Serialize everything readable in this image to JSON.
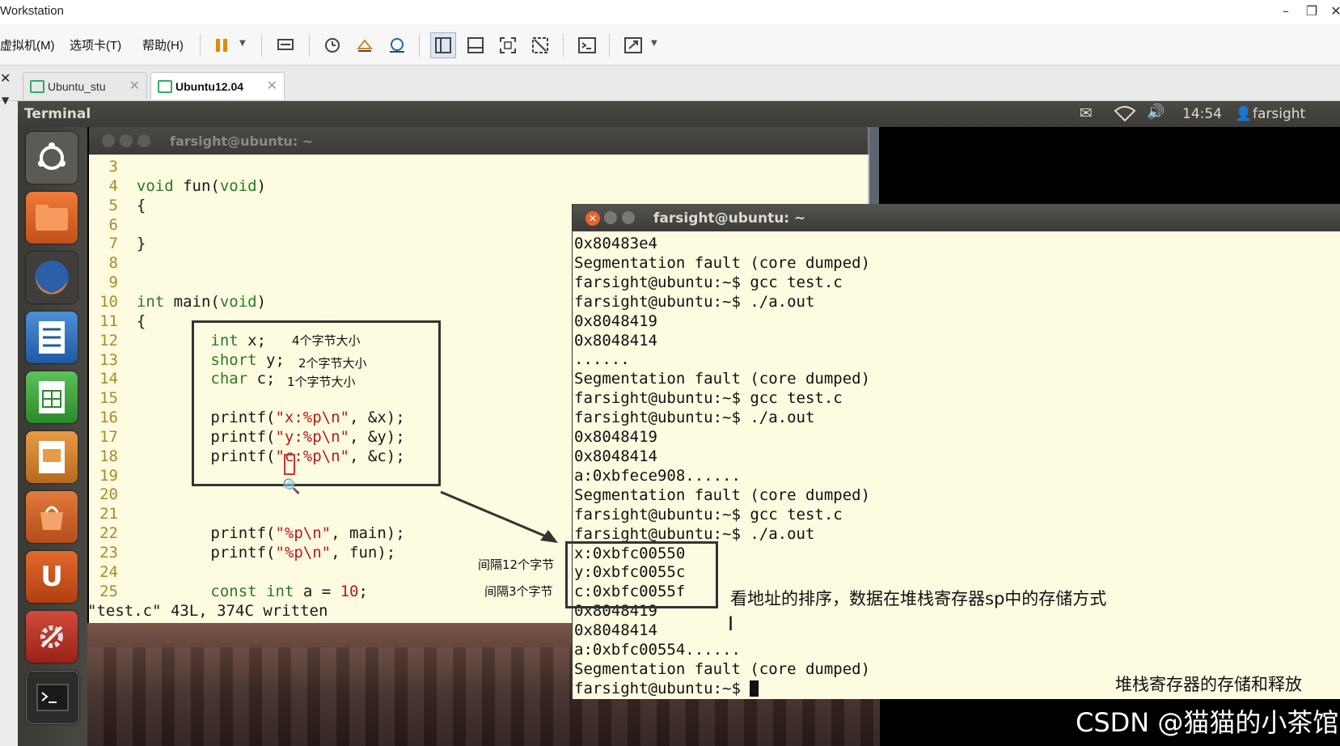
{
  "app": {
    "title": "Workstation"
  },
  "menu": [
    "虚拟机(M)",
    "选项卡(T)",
    "帮助(H)"
  ],
  "tabs": [
    {
      "label": "Ubuntu_stu",
      "active": false
    },
    {
      "label": "Ubuntu12.04",
      "active": true
    }
  ],
  "panel": {
    "app_name": "Terminal",
    "time": "14:54",
    "user": "farsight"
  },
  "vim": {
    "title": "farsight@ubuntu: ~",
    "lines": [
      {
        "n": "3",
        "code": ""
      },
      {
        "n": "4",
        "code": "void fun(void)"
      },
      {
        "n": "5",
        "code": "{"
      },
      {
        "n": "6",
        "code": ""
      },
      {
        "n": "7",
        "code": "}"
      },
      {
        "n": "8",
        "code": ""
      },
      {
        "n": "9",
        "code": ""
      },
      {
        "n": "10",
        "code": "int main(void)"
      },
      {
        "n": "11",
        "code": "{"
      },
      {
        "n": "12",
        "code": "        int x;"
      },
      {
        "n": "13",
        "code": "        short y;"
      },
      {
        "n": "14",
        "code": "        char c;"
      },
      {
        "n": "15",
        "code": ""
      },
      {
        "n": "16",
        "code": "        printf(\"x:%p\\n\", &x);"
      },
      {
        "n": "17",
        "code": "        printf(\"y:%p\\n\", &y);"
      },
      {
        "n": "18",
        "code": "        printf(\"c:%p\\n\", &c);"
      },
      {
        "n": "19",
        "code": ""
      },
      {
        "n": "20",
        "code": ""
      },
      {
        "n": "21",
        "code": ""
      },
      {
        "n": "22",
        "code": "        printf(\"%p\\n\", main);"
      },
      {
        "n": "23",
        "code": "        printf(\"%p\\n\", fun);"
      },
      {
        "n": "24",
        "code": ""
      },
      {
        "n": "25",
        "code": "        const int a = 10;"
      }
    ],
    "status": "\"test.c\" 43L, 374C written"
  },
  "terminal": {
    "title": "farsight@ubuntu: ~",
    "lines": [
      "0x80483e4",
      "Segmentation fault (core dumped)",
      "farsight@ubuntu:~$ gcc test.c",
      "farsight@ubuntu:~$ ./a.out",
      "0x8048419",
      "0x8048414",
      "......",
      "Segmentation fault (core dumped)",
      "farsight@ubuntu:~$ gcc test.c",
      "farsight@ubuntu:~$ ./a.out",
      "0x8048419",
      "0x8048414",
      "a:0xbfece908......",
      "Segmentation fault (core dumped)",
      "farsight@ubuntu:~$ gcc test.c",
      "farsight@ubuntu:~$ ./a.out",
      "x:0xbfc00550",
      "y:0xbfc0055c",
      "c:0xbfc0055f",
      "0x8048419",
      "0x8048414",
      "a:0xbfc00554......",
      "Segmentation fault (core dumped)",
      "farsight@ubuntu:~$ "
    ]
  },
  "annotations": {
    "size_x": "4个字节大小",
    "size_y": "2个字节大小",
    "size_c": "1个字节大小",
    "gap_12": "间隔12个字节",
    "gap_3": "间隔3个字节",
    "order_note": "看地址的排序，数据在堆栈寄存器sp中的存储方式",
    "caption": "堆栈寄存器的存储和释放",
    "watermark": "CSDN @猫猫的小茶馆"
  }
}
